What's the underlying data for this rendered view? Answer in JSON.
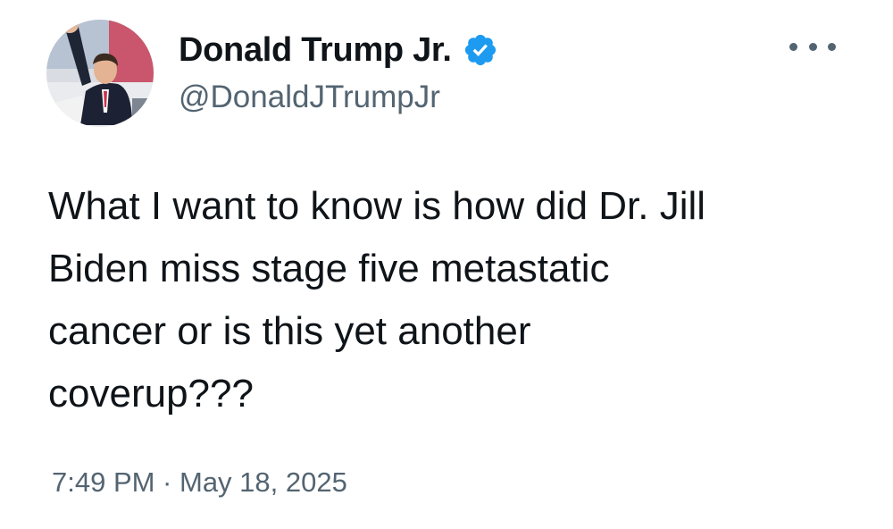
{
  "tweet": {
    "author": {
      "display_name": "Donald Trump Jr.",
      "handle": "@DonaldJTrumpJr",
      "verified_icon": "verified-badge-icon",
      "verified_color": "#1d9bf0"
    },
    "text": "What I want to know is how did Dr. Jill\nBiden miss stage five metastatic\ncancer or is this yet another\ncoverup???",
    "timestamp": "7:49 PM · May 18, 2025",
    "more_icon": "more-options-icon"
  },
  "colors": {
    "primary_text": "#0f1419",
    "secondary_text": "#536471",
    "background": "#ffffff"
  }
}
